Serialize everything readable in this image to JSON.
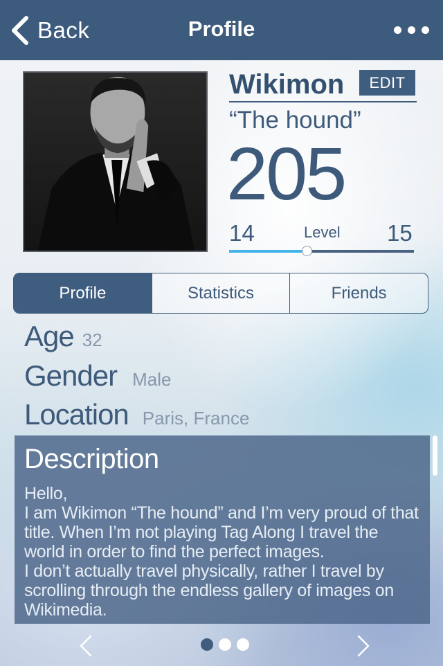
{
  "navbar": {
    "back_label": "Back",
    "title": "Profile"
  },
  "profile": {
    "username": "Wikimon",
    "edit_label": "EDIT",
    "nickname": "“The hound”",
    "score": "205",
    "level": {
      "current": "14",
      "label": "Level",
      "next": "15",
      "progress": 0.42
    }
  },
  "tabs": [
    {
      "label": "Profile",
      "active": true
    },
    {
      "label": "Statistics",
      "active": false
    },
    {
      "label": "Friends",
      "active": false
    }
  ],
  "info": {
    "age_label": "Age",
    "age_value": "32",
    "gender_label": "Gender",
    "gender_value": "Male",
    "location_label": "Location",
    "location_value": "Paris, France"
  },
  "description": {
    "title": "Description",
    "body": "Hello,\nI am Wikimon “The hound” and I’m very proud of that title. When I’m not playing Tag Along I travel the world in order to find the perfect images.\nI don’t actually travel physically, rather I travel by scrolling through the endless gallery of images on Wikimedia."
  },
  "pager": {
    "pages": 3,
    "current": 1
  },
  "colors": {
    "navbar": "#3d5b7c",
    "accent": "#3f5d7e",
    "text": "#3e5a7a",
    "level_fill": "#43b3ea"
  }
}
